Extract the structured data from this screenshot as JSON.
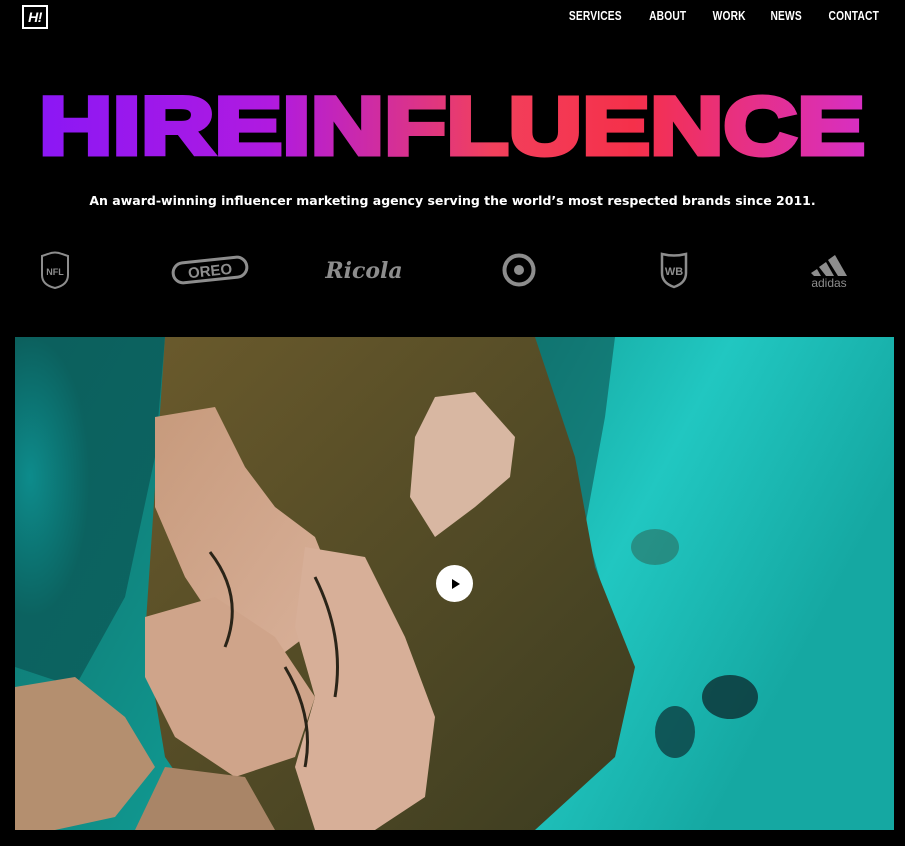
{
  "header": {
    "logo_text": "H!",
    "nav": [
      "SERVICES",
      "ABOUT",
      "WORK",
      "NEWS",
      "CONTACT"
    ]
  },
  "hero": {
    "title": "HIREINFLUENCE",
    "gradient": [
      "#8b17f5",
      "#b01ae0",
      "#f2405c",
      "#f5304a",
      "#d72fc4"
    ],
    "tagline": "An award-winning influencer marketing agency serving the world’s most respected brands since 2011."
  },
  "brands": {
    "nfl": "NFL",
    "oreo": "OREO",
    "ricola": "Ricola",
    "target": "",
    "wb": "WB",
    "adidas": "adidas",
    "color": "#8d8d8d"
  },
  "video": {
    "play_icon": "play-icon"
  }
}
